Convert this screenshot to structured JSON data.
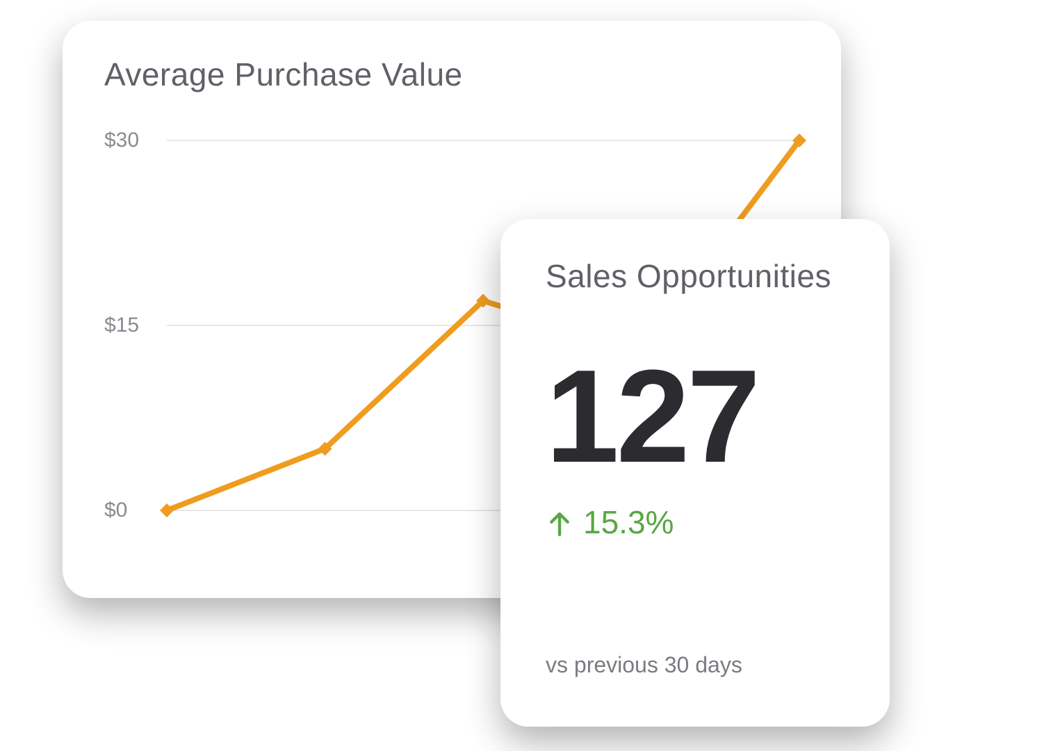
{
  "chart_data": {
    "type": "line",
    "title": "Average Purchase Value",
    "xlabel": "",
    "ylabel": "",
    "ylim": [
      0,
      30
    ],
    "y_ticks": [
      "$30",
      "$15",
      "$0"
    ],
    "x": [
      0,
      1,
      2,
      3,
      4
    ],
    "values": [
      0,
      5,
      17,
      13,
      30
    ],
    "line_color": "#ef9c1f"
  },
  "metric": {
    "title": "Sales Opportunities",
    "value": "127",
    "delta": "15.3%",
    "delta_direction": "up",
    "delta_color": "#58a744",
    "compare_label": "vs previous 30 days"
  }
}
